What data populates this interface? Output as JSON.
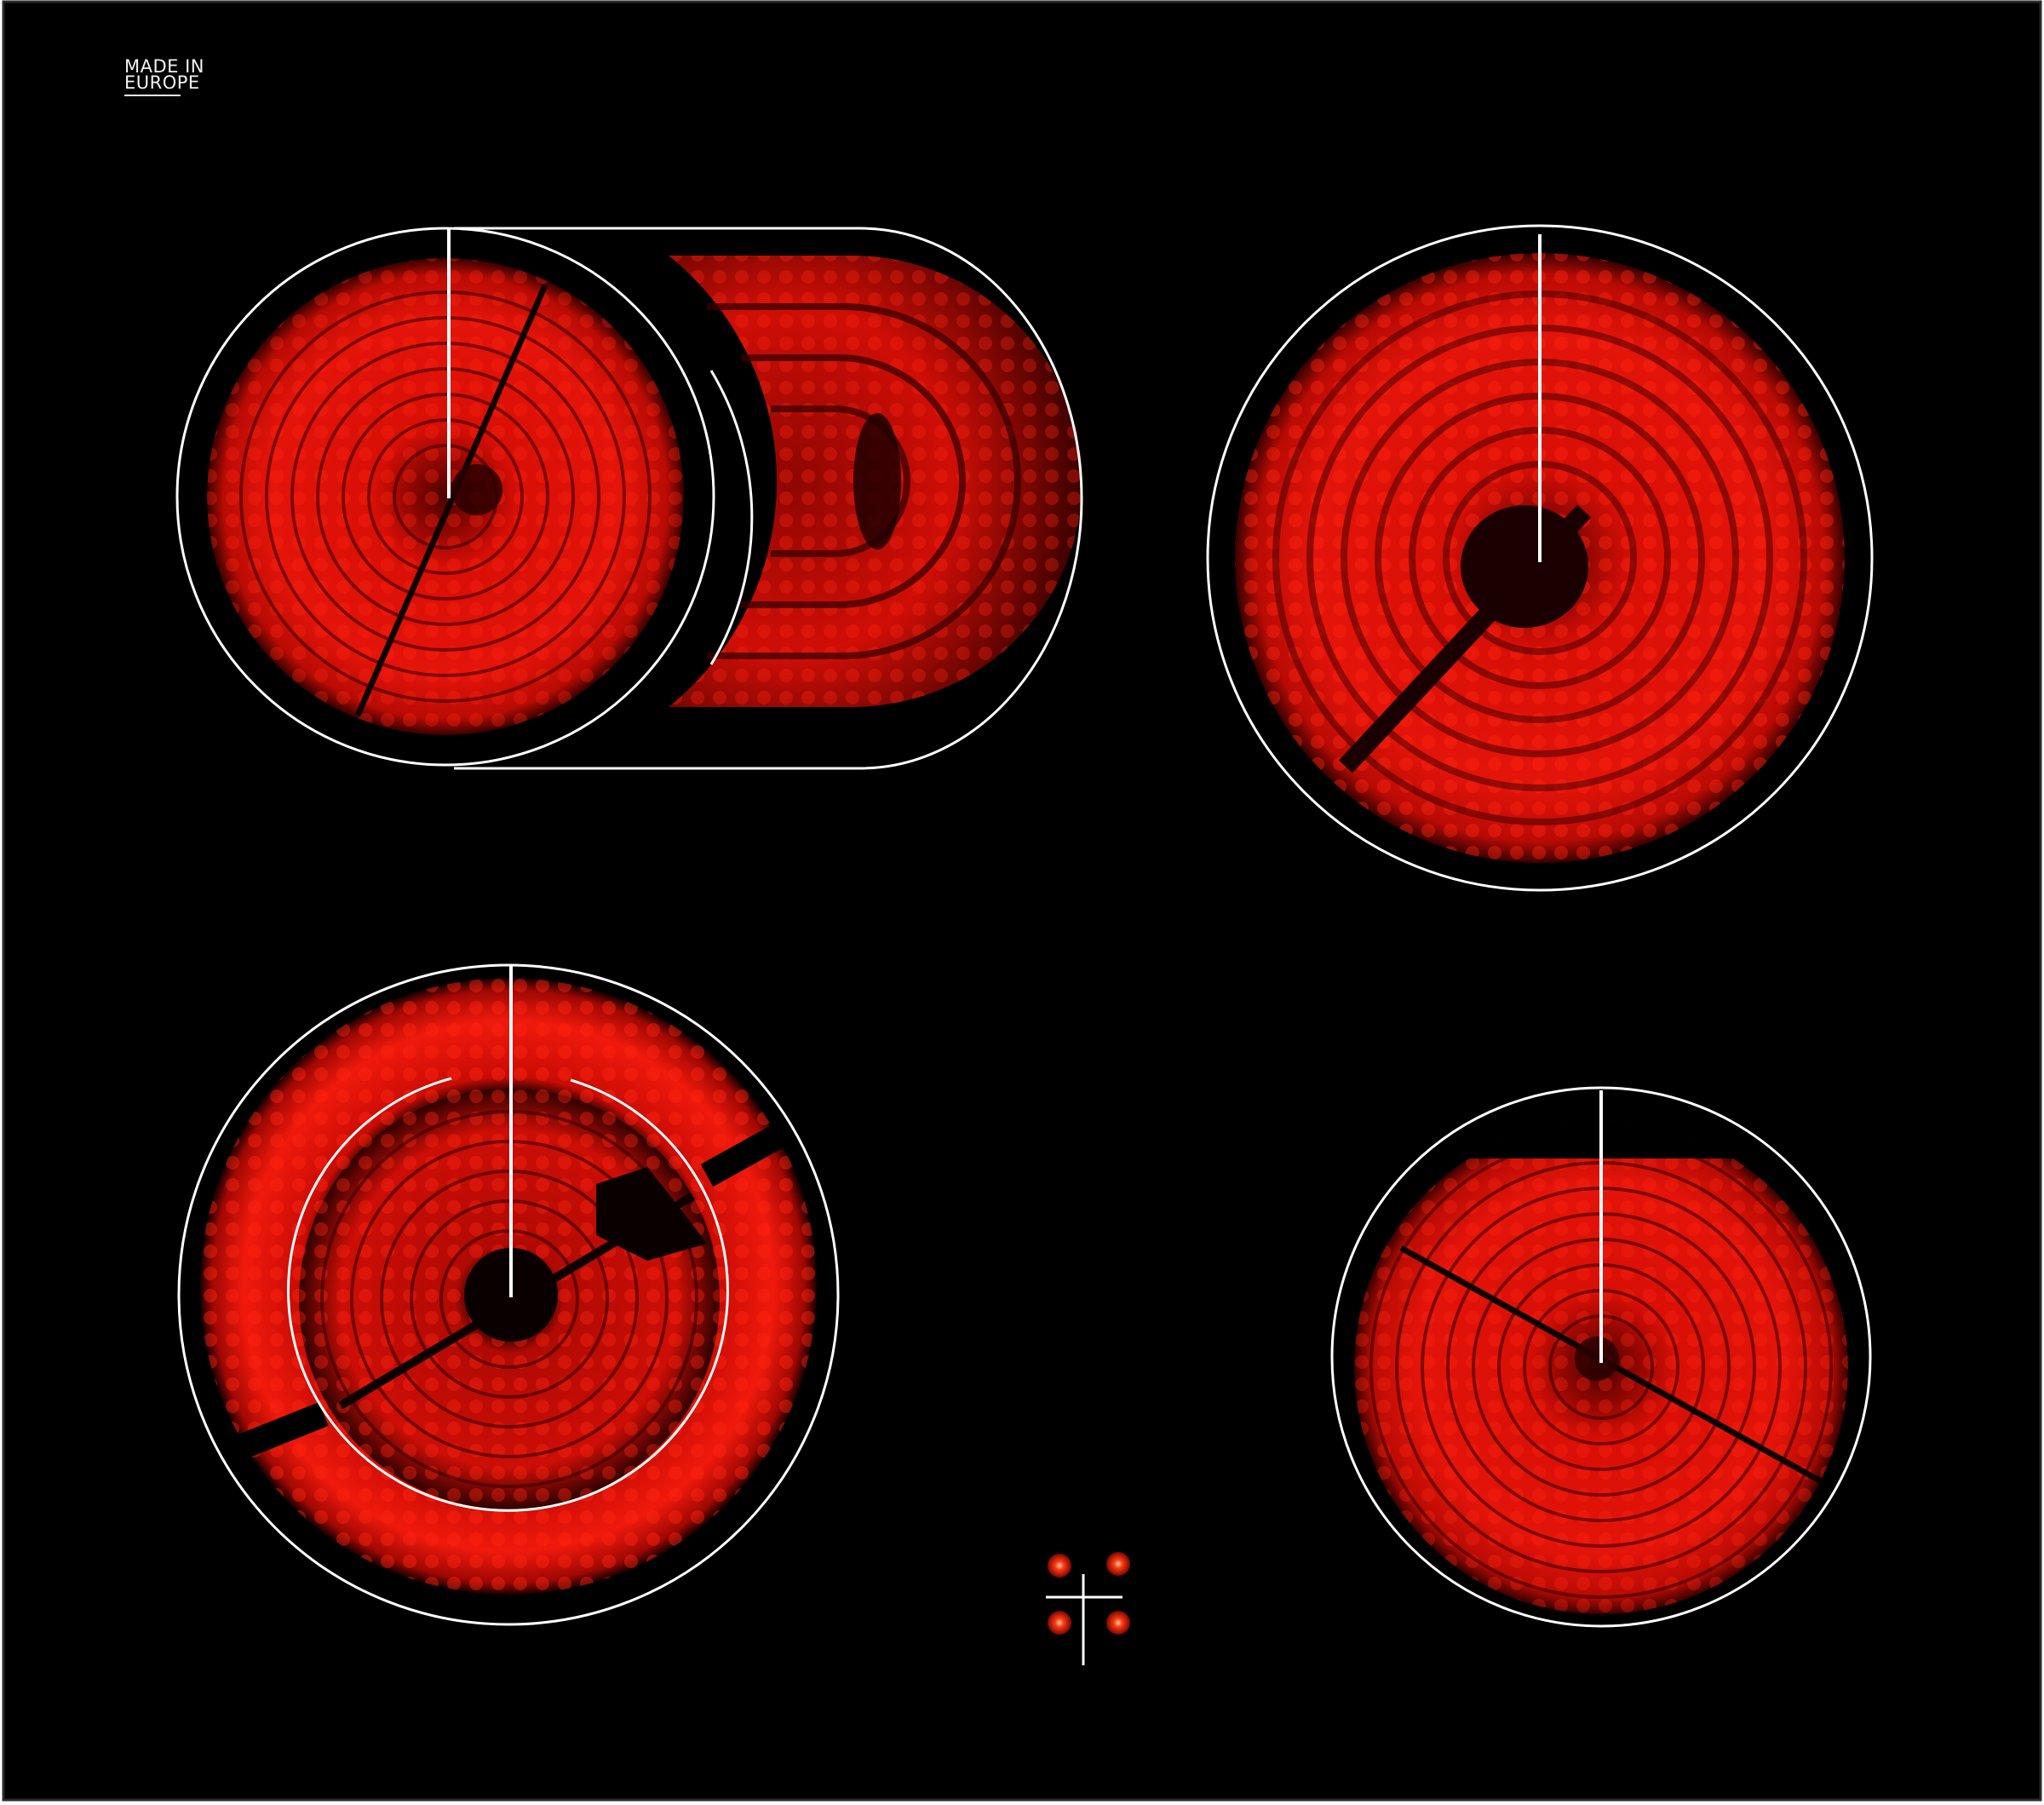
{
  "label": {
    "line1": "MADE IN",
    "line2": "EUROPE"
  },
  "colors": {
    "glass": "#000000",
    "glow_bright": "#ff1a0a",
    "glow_mid": "#d40d05",
    "glow_dark": "#5a0301",
    "marking_line": "#ffffff"
  },
  "zones": [
    {
      "name": "rear-left-dual-oval-zone",
      "heating_rings_visible": 2
    },
    {
      "name": "rear-right-large-zone",
      "heating_rings_visible": 1
    },
    {
      "name": "front-left-dual-circuit-zone",
      "heating_rings_visible": 2
    },
    {
      "name": "front-right-zone",
      "heating_rings_visible": 1
    }
  ],
  "control_indicator": {
    "lights": 4,
    "icon": "four-zone-residual-heat-icon"
  }
}
